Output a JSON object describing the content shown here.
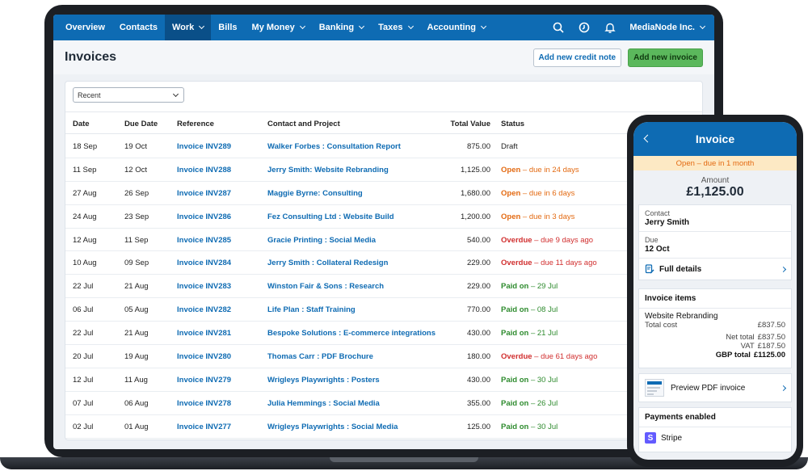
{
  "nav": {
    "items": [
      {
        "label": "Overview",
        "dropdown": false,
        "active": false
      },
      {
        "label": "Contacts",
        "dropdown": false,
        "active": false
      },
      {
        "label": "Work",
        "dropdown": true,
        "active": true
      },
      {
        "label": "Bills",
        "dropdown": false,
        "active": false
      },
      {
        "label": "My Money",
        "dropdown": true,
        "active": false
      },
      {
        "label": "Banking",
        "dropdown": true,
        "active": false
      },
      {
        "label": "Taxes",
        "dropdown": true,
        "active": false
      },
      {
        "label": "Accounting",
        "dropdown": true,
        "active": false
      }
    ],
    "icons": [
      "search-icon",
      "timer-icon",
      "bell-icon"
    ],
    "org_name": "MediaNode Inc."
  },
  "page": {
    "title": "Invoices",
    "credit_note_button": "Add new credit note",
    "new_invoice_button": "Add new invoice"
  },
  "filter": {
    "selected": "Recent"
  },
  "table": {
    "headers": {
      "date": "Date",
      "due": "Due Date",
      "reference": "Reference",
      "contact": "Contact and Project",
      "total": "Total Value",
      "status": "Status"
    },
    "rows": [
      {
        "date": "18 Sep",
        "due": "19 Oct",
        "ref": "Invoice INV289",
        "contact": "Walker Forbes : Consultation Report",
        "total": "875.00",
        "status": "Draft",
        "status_detail": "",
        "kind": "draft"
      },
      {
        "date": "11 Sep",
        "due": "12 Oct",
        "ref": "Invoice INV288",
        "contact": "Jerry Smith: Website Rebranding",
        "total": "1,125.00",
        "status": "Open",
        "status_detail": " – due in 24 days",
        "kind": "open"
      },
      {
        "date": "27 Aug",
        "due": "26 Sep",
        "ref": "Invoice INV287",
        "contact": "Maggie Byrne: Consulting",
        "total": "1,680.00",
        "status": "Open",
        "status_detail": " – due in 6 days",
        "kind": "open"
      },
      {
        "date": "24 Aug",
        "due": "23 Sep",
        "ref": "Invoice INV286",
        "contact": "Fez Consulting Ltd : Website Build",
        "total": "1,200.00",
        "status": "Open",
        "status_detail": " – due in 3 days",
        "kind": "open"
      },
      {
        "date": "12 Aug",
        "due": "11 Sep",
        "ref": "Invoice INV285",
        "contact": "Gracie Printing : Social Media",
        "total": "540.00",
        "status": "Overdue",
        "status_detail": " – due 9 days ago",
        "kind": "over"
      },
      {
        "date": "10 Aug",
        "due": "09 Sep",
        "ref": "Invoice INV284",
        "contact": "Jerry Smith : Collateral Redesign",
        "total": "229.00",
        "status": "Overdue",
        "status_detail": " – due 11 days ago",
        "kind": "over"
      },
      {
        "date": "22 Jul",
        "due": "21 Aug",
        "ref": "Invoice INV283",
        "contact": "Winston Fair & Sons : Research",
        "total": "229.00",
        "status": "Paid on",
        "status_detail": " – 29 Jul",
        "kind": "paid"
      },
      {
        "date": "06 Jul",
        "due": "05 Aug",
        "ref": "Invoice INV282",
        "contact": "Life Plan : Staff Training",
        "total": "770.00",
        "status": "Paid on",
        "status_detail": " – 08 Jul",
        "kind": "paid"
      },
      {
        "date": "22 Jul",
        "due": "21 Aug",
        "ref": "Invoice INV281",
        "contact": "Bespoke Solutions : E-commerce integrations",
        "total": "430.00",
        "status": "Paid on",
        "status_detail": " – 21 Jul",
        "kind": "paid"
      },
      {
        "date": "20 Jul",
        "due": "19 Aug",
        "ref": "Invoice INV280",
        "contact": "Thomas Carr : PDF Brochure",
        "total": "180.00",
        "status": "Overdue",
        "status_detail": " – due 61 days ago",
        "kind": "over"
      },
      {
        "date": "12 Jul",
        "due": "11 Aug",
        "ref": "Invoice INV279",
        "contact": "Wrigleys Playwrights : Posters",
        "total": "430.00",
        "status": "Paid on",
        "status_detail": " – 30 Jul",
        "kind": "paid"
      },
      {
        "date": "07 Jul",
        "due": "06 Aug",
        "ref": "Invoice INV278",
        "contact": "Julia Hemmings : Social Media",
        "total": "355.00",
        "status": "Paid on",
        "status_detail": " – 26 Jul",
        "kind": "paid"
      },
      {
        "date": "02 Jul",
        "due": "01 Aug",
        "ref": "Invoice INV277",
        "contact": "Wrigleys Playwrights : Social Media",
        "total": "125.00",
        "status": "Paid on",
        "status_detail": " – 30 Jul",
        "kind": "paid"
      }
    ]
  },
  "phone": {
    "title": "Invoice",
    "banner": "Open – due in 1 month",
    "amount_label": "Amount",
    "amount": "£1,125.00",
    "contact_label": "Contact",
    "contact_value": "Jerry Smith",
    "due_label": "Due",
    "due_value": "12 Oct",
    "full_details": "Full details",
    "items_title": "Invoice items",
    "item_name": "Website Rebranding",
    "total_cost_label": "Total cost",
    "total_cost_value": "£837.50",
    "net_total_label": "Net total",
    "net_total_value": "£837.50",
    "vat_label": "VAT",
    "vat_value": "£187.50",
    "gbp_total_label": "GBP total",
    "gbp_total_value": "£1125.00",
    "preview_pdf": "Preview PDF invoice",
    "payments_title": "Payments enabled",
    "stripe_label": "Stripe",
    "stripe_logo_letter": "S"
  },
  "colors": {
    "nav_blue": "#0e6bb3",
    "nav_active": "#0a4f88",
    "open": "#e36a12",
    "overdue": "#d12f2f",
    "paid": "#2e8b2e",
    "green_button": "#5bb85c",
    "stripe": "#635bff"
  }
}
